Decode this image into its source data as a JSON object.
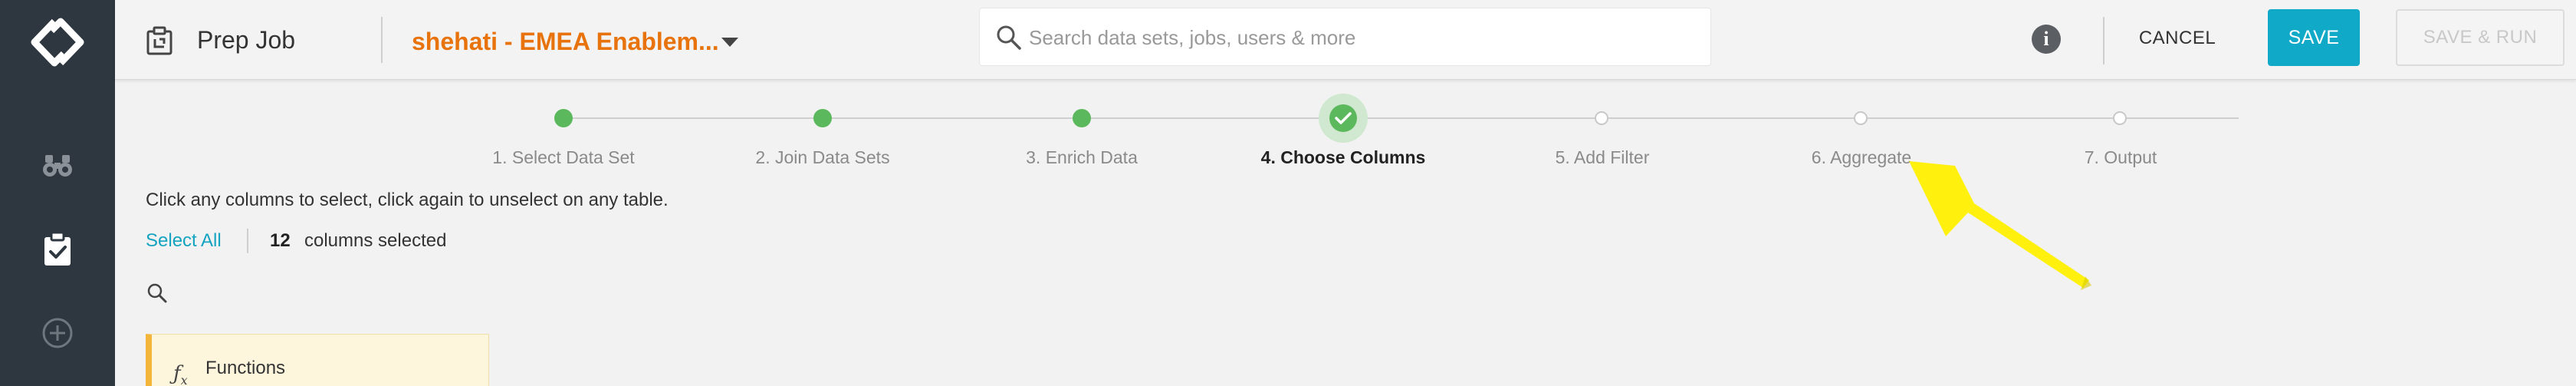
{
  "header": {
    "page_title": "Prep Job",
    "project_name": "shehati - EMEA Enablem...",
    "search_placeholder": "Search data sets, jobs, users & more",
    "info_label": "i",
    "cancel_label": "CANCEL",
    "save_label": "SAVE",
    "save_run_label": "SAVE & RUN"
  },
  "sidebar": {
    "items": [
      {
        "icon": "binoculars-icon"
      },
      {
        "icon": "clipboard-check-icon",
        "active": true
      },
      {
        "icon": "plus-circle-icon"
      }
    ]
  },
  "stepper": {
    "steps": [
      {
        "label": "1. Select Data Set",
        "state": "complete"
      },
      {
        "label": "2. Join Data Sets",
        "state": "complete"
      },
      {
        "label": "3. Enrich Data",
        "state": "complete"
      },
      {
        "label": "4. Choose Columns",
        "state": "current"
      },
      {
        "label": "5. Add Filter",
        "state": "pending"
      },
      {
        "label": "6. Aggregate",
        "state": "pending"
      },
      {
        "label": "7. Output",
        "state": "pending"
      }
    ]
  },
  "main": {
    "instructions": "Click any columns to select, click again to unselect on any table.",
    "select_all_label": "Select All",
    "selected_count": "12",
    "selected_label": "columns selected",
    "functions_label": "Functions"
  },
  "colors": {
    "accent": "#10a9c7",
    "project": "#e8730c",
    "step_complete": "#5cb85c",
    "rail": "#2e3740",
    "annotation_arrow": "#ffee00"
  }
}
